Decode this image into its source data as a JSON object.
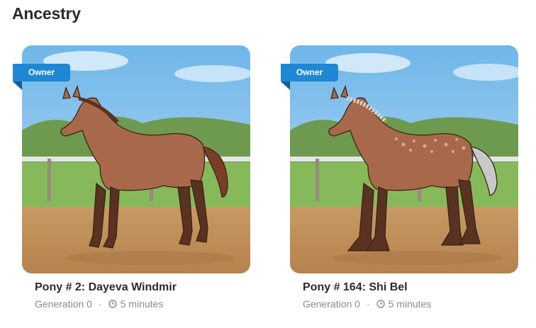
{
  "section": {
    "title": "Ancestry"
  },
  "owner_badge_label": "Owner",
  "colors": {
    "badge": "#1e88d4",
    "badge_fold": "#0f5f96",
    "title": "#2b2b2b",
    "meta": "#8a8a8a"
  },
  "ponies": [
    {
      "name": "Pony # 2: Dayeva Windmir",
      "generation": "Generation 0",
      "time": "5 minutes",
      "image": "horse-bay-plain"
    },
    {
      "name": "Pony # 164: Shi Bel",
      "generation": "Generation 0",
      "time": "5 minutes",
      "image": "horse-bay-roan-feathered"
    }
  ]
}
